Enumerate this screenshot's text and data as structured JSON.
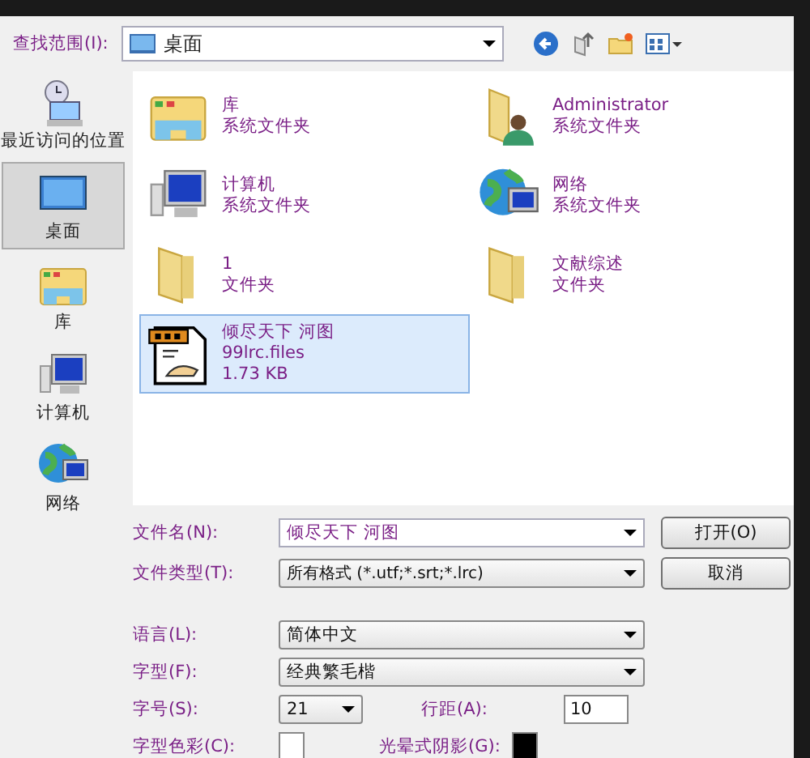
{
  "look_in": {
    "label": "查找范围(I):",
    "value": "桌面"
  },
  "places": [
    {
      "label": "最近访问的位置",
      "kind": "recent",
      "selected": false
    },
    {
      "label": "桌面",
      "kind": "desktop",
      "selected": true
    },
    {
      "label": "库",
      "kind": "library",
      "selected": false
    },
    {
      "label": "计算机",
      "kind": "computer",
      "selected": false
    },
    {
      "label": "网络",
      "kind": "network",
      "selected": false
    }
  ],
  "files": [
    {
      "name": "库",
      "type": "系统文件夹",
      "kind": "library",
      "selected": false
    },
    {
      "name": "Administrator",
      "type": "系统文件夹",
      "kind": "user",
      "selected": false
    },
    {
      "name": "计算机",
      "type": "系统文件夹",
      "kind": "computer",
      "selected": false
    },
    {
      "name": "网络",
      "type": "系统文件夹",
      "kind": "network",
      "selected": false
    },
    {
      "name": "1",
      "type": "文件夹",
      "kind": "folder",
      "selected": false
    },
    {
      "name": "文献综述",
      "type": "文件夹",
      "kind": "folder",
      "selected": false
    },
    {
      "name": "倾尽天下 河图",
      "type": "99lrc.files",
      "size": "1.73 KB",
      "kind": "lrc",
      "selected": true
    }
  ],
  "file_name": {
    "label": "文件名(N):",
    "value": "倾尽天下 河图"
  },
  "file_type": {
    "label": "文件类型(T):",
    "value": "所有格式 (*.utf;*.srt;*.lrc)"
  },
  "buttons": [
    "打开(O)",
    "取消"
  ],
  "language": {
    "label": "语言(L):",
    "value": "简体中文"
  },
  "font": {
    "label": "字型(F):",
    "value": "经典繁毛楷"
  },
  "size": {
    "label": "字号(S):",
    "value": "21"
  },
  "line_spacing": {
    "label": "行距(A):",
    "value": "10"
  },
  "font_color": {
    "label": "字型色彩(C):",
    "color": "#ffffff"
  },
  "halo_shadow": {
    "label": "光晕式阴影(G):",
    "color": "#000000"
  }
}
